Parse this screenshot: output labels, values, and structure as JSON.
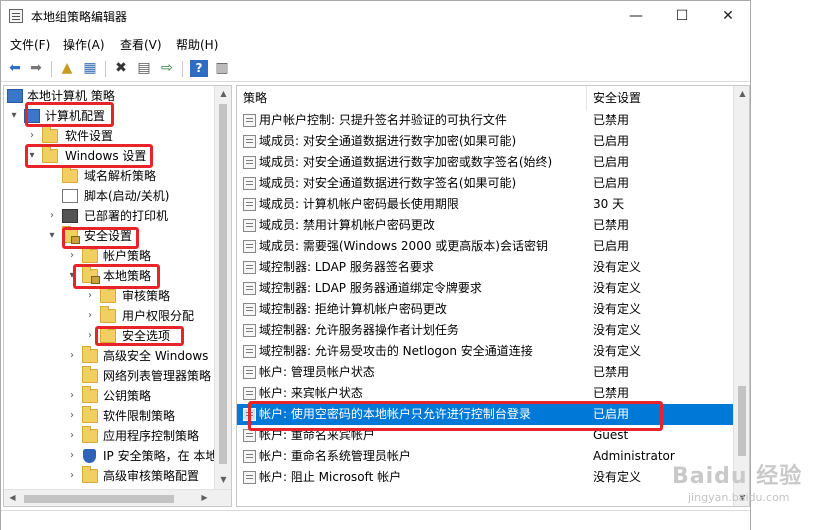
{
  "window": {
    "title": "本地组策略编辑器",
    "controls": {
      "minimize": "—",
      "maximize": "☐",
      "close": "✕"
    }
  },
  "menubar": [
    "文件(F)",
    "操作(A)",
    "查看(V)",
    "帮助(H)"
  ],
  "toolbar": {
    "icons": [
      "back-arrow-icon",
      "forward-arrow-icon",
      "up-folder-icon",
      "show-hide-tree-icon",
      "delete-icon",
      "properties-icon",
      "export-list-icon",
      "help-icon",
      "view-icon"
    ]
  },
  "tree": {
    "items": [
      {
        "label": "本地计算机 策略",
        "icon": "computer-icon"
      },
      {
        "label": "计算机配置",
        "icon": "computer-icon"
      },
      {
        "label": "软件设置",
        "icon": "folder-icon"
      },
      {
        "label": "Windows 设置",
        "icon": "folder-icon"
      },
      {
        "label": "域名解析策略",
        "icon": "folder-icon"
      },
      {
        "label": "脚本(启动/关机)",
        "icon": "script-icon"
      },
      {
        "label": "已部署的打印机",
        "icon": "printer-icon"
      },
      {
        "label": "安全设置",
        "icon": "security-icon"
      },
      {
        "label": "帐户策略",
        "icon": "folder-icon"
      },
      {
        "label": "本地策略",
        "icon": "folder-icon"
      },
      {
        "label": "审核策略",
        "icon": "folder-icon"
      },
      {
        "label": "用户权限分配",
        "icon": "folder-icon"
      },
      {
        "label": "安全选项",
        "icon": "folder-icon"
      },
      {
        "label": "高级安全 Windows",
        "icon": "folder-icon"
      },
      {
        "label": "网络列表管理器策略",
        "icon": "folder-icon"
      },
      {
        "label": "公钥策略",
        "icon": "folder-icon"
      },
      {
        "label": "软件限制策略",
        "icon": "folder-icon"
      },
      {
        "label": "应用程序控制策略",
        "icon": "folder-icon"
      },
      {
        "label": "IP 安全策略，在 本地",
        "icon": "shield-icon"
      },
      {
        "label": "高级审核策略配置",
        "icon": "folder-icon"
      }
    ]
  },
  "list": {
    "headers": {
      "policy": "策略",
      "setting": "安全设置"
    },
    "rows": [
      {
        "policy": "用户帐户控制: 只提升签名并验证的可执行文件",
        "setting": "已禁用"
      },
      {
        "policy": "域成员: 对安全通道数据进行数字加密(如果可能)",
        "setting": "已启用"
      },
      {
        "policy": "域成员: 对安全通道数据进行数字加密或数字签名(始终)",
        "setting": "已启用"
      },
      {
        "policy": "域成员: 对安全通道数据进行数字签名(如果可能)",
        "setting": "已启用"
      },
      {
        "policy": "域成员: 计算机帐户密码最长使用期限",
        "setting": "30 天"
      },
      {
        "policy": "域成员: 禁用计算机帐户密码更改",
        "setting": "已禁用"
      },
      {
        "policy": "域成员: 需要强(Windows 2000 或更高版本)会话密钥",
        "setting": "已启用"
      },
      {
        "policy": "域控制器: LDAP 服务器签名要求",
        "setting": "没有定义"
      },
      {
        "policy": "域控制器: LDAP 服务器通道绑定令牌要求",
        "setting": "没有定义"
      },
      {
        "policy": "域控制器: 拒绝计算机帐户密码更改",
        "setting": "没有定义"
      },
      {
        "policy": "域控制器: 允许服务器操作者计划任务",
        "setting": "没有定义"
      },
      {
        "policy": "域控制器: 允许易受攻击的 Netlogon 安全通道连接",
        "setting": "没有定义"
      },
      {
        "policy": "帐户: 管理员帐户状态",
        "setting": "已禁用"
      },
      {
        "policy": "帐户: 来宾帐户状态",
        "setting": "已禁用"
      },
      {
        "policy": "帐户: 使用空密码的本地帐户只允许进行控制台登录",
        "setting": "已启用"
      },
      {
        "policy": "帐户: 重命名来宾帐户",
        "setting": "Guest"
      },
      {
        "policy": "帐户: 重命名系统管理员帐户",
        "setting": "Administrator"
      },
      {
        "policy": "帐户: 阻止 Microsoft 帐户",
        "setting": "没有定义"
      }
    ]
  },
  "watermark": {
    "main": "Baidu 经验",
    "sub": "jingyan.baidu.com"
  },
  "colors": {
    "highlight_red": "#e8242b",
    "selection_blue": "#0078d7"
  }
}
